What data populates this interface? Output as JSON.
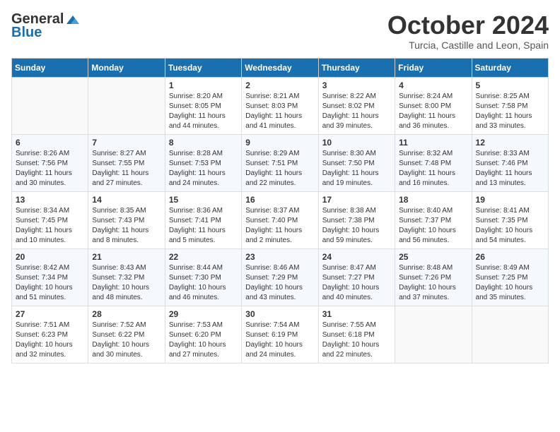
{
  "logo": {
    "general": "General",
    "blue": "Blue"
  },
  "title": "October 2024",
  "location": "Turcia, Castille and Leon, Spain",
  "days_header": [
    "Sunday",
    "Monday",
    "Tuesday",
    "Wednesday",
    "Thursday",
    "Friday",
    "Saturday"
  ],
  "weeks": [
    [
      {
        "day": "",
        "sunrise": "",
        "sunset": "",
        "daylight": "",
        "empty": true
      },
      {
        "day": "",
        "sunrise": "",
        "sunset": "",
        "daylight": "",
        "empty": true
      },
      {
        "day": "1",
        "sunrise": "Sunrise: 8:20 AM",
        "sunset": "Sunset: 8:05 PM",
        "daylight": "Daylight: 11 hours and 44 minutes.",
        "empty": false
      },
      {
        "day": "2",
        "sunrise": "Sunrise: 8:21 AM",
        "sunset": "Sunset: 8:03 PM",
        "daylight": "Daylight: 11 hours and 41 minutes.",
        "empty": false
      },
      {
        "day": "3",
        "sunrise": "Sunrise: 8:22 AM",
        "sunset": "Sunset: 8:02 PM",
        "daylight": "Daylight: 11 hours and 39 minutes.",
        "empty": false
      },
      {
        "day": "4",
        "sunrise": "Sunrise: 8:24 AM",
        "sunset": "Sunset: 8:00 PM",
        "daylight": "Daylight: 11 hours and 36 minutes.",
        "empty": false
      },
      {
        "day": "5",
        "sunrise": "Sunrise: 8:25 AM",
        "sunset": "Sunset: 7:58 PM",
        "daylight": "Daylight: 11 hours and 33 minutes.",
        "empty": false
      }
    ],
    [
      {
        "day": "6",
        "sunrise": "Sunrise: 8:26 AM",
        "sunset": "Sunset: 7:56 PM",
        "daylight": "Daylight: 11 hours and 30 minutes.",
        "empty": false
      },
      {
        "day": "7",
        "sunrise": "Sunrise: 8:27 AM",
        "sunset": "Sunset: 7:55 PM",
        "daylight": "Daylight: 11 hours and 27 minutes.",
        "empty": false
      },
      {
        "day": "8",
        "sunrise": "Sunrise: 8:28 AM",
        "sunset": "Sunset: 7:53 PM",
        "daylight": "Daylight: 11 hours and 24 minutes.",
        "empty": false
      },
      {
        "day": "9",
        "sunrise": "Sunrise: 8:29 AM",
        "sunset": "Sunset: 7:51 PM",
        "daylight": "Daylight: 11 hours and 22 minutes.",
        "empty": false
      },
      {
        "day": "10",
        "sunrise": "Sunrise: 8:30 AM",
        "sunset": "Sunset: 7:50 PM",
        "daylight": "Daylight: 11 hours and 19 minutes.",
        "empty": false
      },
      {
        "day": "11",
        "sunrise": "Sunrise: 8:32 AM",
        "sunset": "Sunset: 7:48 PM",
        "daylight": "Daylight: 11 hours and 16 minutes.",
        "empty": false
      },
      {
        "day": "12",
        "sunrise": "Sunrise: 8:33 AM",
        "sunset": "Sunset: 7:46 PM",
        "daylight": "Daylight: 11 hours and 13 minutes.",
        "empty": false
      }
    ],
    [
      {
        "day": "13",
        "sunrise": "Sunrise: 8:34 AM",
        "sunset": "Sunset: 7:45 PM",
        "daylight": "Daylight: 11 hours and 10 minutes.",
        "empty": false
      },
      {
        "day": "14",
        "sunrise": "Sunrise: 8:35 AM",
        "sunset": "Sunset: 7:43 PM",
        "daylight": "Daylight: 11 hours and 8 minutes.",
        "empty": false
      },
      {
        "day": "15",
        "sunrise": "Sunrise: 8:36 AM",
        "sunset": "Sunset: 7:41 PM",
        "daylight": "Daylight: 11 hours and 5 minutes.",
        "empty": false
      },
      {
        "day": "16",
        "sunrise": "Sunrise: 8:37 AM",
        "sunset": "Sunset: 7:40 PM",
        "daylight": "Daylight: 11 hours and 2 minutes.",
        "empty": false
      },
      {
        "day": "17",
        "sunrise": "Sunrise: 8:38 AM",
        "sunset": "Sunset: 7:38 PM",
        "daylight": "Daylight: 10 hours and 59 minutes.",
        "empty": false
      },
      {
        "day": "18",
        "sunrise": "Sunrise: 8:40 AM",
        "sunset": "Sunset: 7:37 PM",
        "daylight": "Daylight: 10 hours and 56 minutes.",
        "empty": false
      },
      {
        "day": "19",
        "sunrise": "Sunrise: 8:41 AM",
        "sunset": "Sunset: 7:35 PM",
        "daylight": "Daylight: 10 hours and 54 minutes.",
        "empty": false
      }
    ],
    [
      {
        "day": "20",
        "sunrise": "Sunrise: 8:42 AM",
        "sunset": "Sunset: 7:34 PM",
        "daylight": "Daylight: 10 hours and 51 minutes.",
        "empty": false
      },
      {
        "day": "21",
        "sunrise": "Sunrise: 8:43 AM",
        "sunset": "Sunset: 7:32 PM",
        "daylight": "Daylight: 10 hours and 48 minutes.",
        "empty": false
      },
      {
        "day": "22",
        "sunrise": "Sunrise: 8:44 AM",
        "sunset": "Sunset: 7:30 PM",
        "daylight": "Daylight: 10 hours and 46 minutes.",
        "empty": false
      },
      {
        "day": "23",
        "sunrise": "Sunrise: 8:46 AM",
        "sunset": "Sunset: 7:29 PM",
        "daylight": "Daylight: 10 hours and 43 minutes.",
        "empty": false
      },
      {
        "day": "24",
        "sunrise": "Sunrise: 8:47 AM",
        "sunset": "Sunset: 7:27 PM",
        "daylight": "Daylight: 10 hours and 40 minutes.",
        "empty": false
      },
      {
        "day": "25",
        "sunrise": "Sunrise: 8:48 AM",
        "sunset": "Sunset: 7:26 PM",
        "daylight": "Daylight: 10 hours and 37 minutes.",
        "empty": false
      },
      {
        "day": "26",
        "sunrise": "Sunrise: 8:49 AM",
        "sunset": "Sunset: 7:25 PM",
        "daylight": "Daylight: 10 hours and 35 minutes.",
        "empty": false
      }
    ],
    [
      {
        "day": "27",
        "sunrise": "Sunrise: 7:51 AM",
        "sunset": "Sunset: 6:23 PM",
        "daylight": "Daylight: 10 hours and 32 minutes.",
        "empty": false
      },
      {
        "day": "28",
        "sunrise": "Sunrise: 7:52 AM",
        "sunset": "Sunset: 6:22 PM",
        "daylight": "Daylight: 10 hours and 30 minutes.",
        "empty": false
      },
      {
        "day": "29",
        "sunrise": "Sunrise: 7:53 AM",
        "sunset": "Sunset: 6:20 PM",
        "daylight": "Daylight: 10 hours and 27 minutes.",
        "empty": false
      },
      {
        "day": "30",
        "sunrise": "Sunrise: 7:54 AM",
        "sunset": "Sunset: 6:19 PM",
        "daylight": "Daylight: 10 hours and 24 minutes.",
        "empty": false
      },
      {
        "day": "31",
        "sunrise": "Sunrise: 7:55 AM",
        "sunset": "Sunset: 6:18 PM",
        "daylight": "Daylight: 10 hours and 22 minutes.",
        "empty": false
      },
      {
        "day": "",
        "sunrise": "",
        "sunset": "",
        "daylight": "",
        "empty": true
      },
      {
        "day": "",
        "sunrise": "",
        "sunset": "",
        "daylight": "",
        "empty": true
      }
    ]
  ]
}
